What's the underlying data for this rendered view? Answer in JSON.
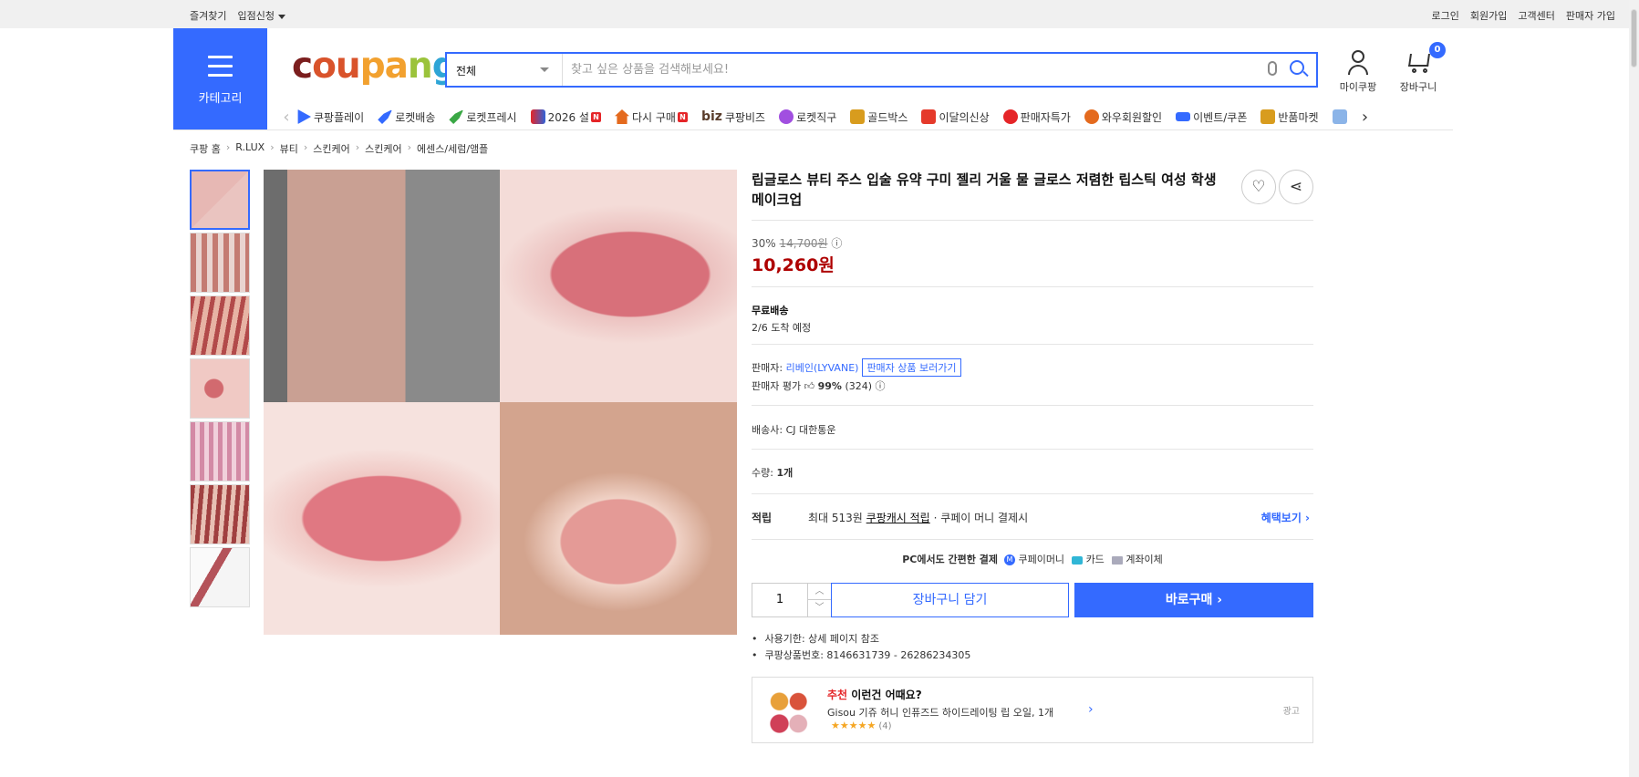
{
  "topbar": {
    "left": [
      "즐겨찾기",
      "입점신청"
    ],
    "right": [
      "로그인",
      "회원가입",
      "고객센터",
      "판매자 가입"
    ]
  },
  "header": {
    "category_label": "카테고리",
    "logo": [
      "c",
      "ou",
      "pa",
      "n",
      "g"
    ],
    "search": {
      "category": "전체",
      "placeholder": "찾고 싶은 상품을 검색해보세요!"
    },
    "mycoupang": "마이쿠팡",
    "cart": "장바구니",
    "cart_count": "0"
  },
  "nav": {
    "items": [
      {
        "label": "쿠팡플레이",
        "icon": "play-icon",
        "color": "#346aff",
        "new": ""
      },
      {
        "label": "로켓배송",
        "icon": "rocket-icon",
        "color": "#346aff",
        "new": ""
      },
      {
        "label": "로켓프레시",
        "icon": "rocket-fresh-icon",
        "color": "#3aa845",
        "new": ""
      },
      {
        "label": "2026 설",
        "icon": "gift-icon",
        "color": "#2f63d8",
        "new": "N"
      },
      {
        "label": "다시 구매",
        "icon": "house-icon",
        "color": "#e46a1e",
        "new": "N"
      },
      {
        "label": "쿠팡비즈",
        "icon": "biz-icon",
        "color": "#5a3d2b",
        "new": ""
      },
      {
        "label": "로켓직구",
        "icon": "globe-icon",
        "color": "#a14fe0",
        "new": ""
      },
      {
        "label": "골드박스",
        "icon": "goldbox-icon",
        "color": "#d89c1e",
        "new": ""
      },
      {
        "label": "이달의신상",
        "icon": "bag-icon",
        "color": "#e53a2b",
        "new": ""
      },
      {
        "label": "판매자특가",
        "icon": "percent-icon",
        "color": "#e52528",
        "new": ""
      },
      {
        "label": "와우회원할인",
        "icon": "wow-icon",
        "color": "#e46a1e",
        "new": ""
      },
      {
        "label": "이벤트/쿠폰",
        "icon": "coupon-icon",
        "color": "#346aff",
        "new": ""
      },
      {
        "label": "반품마켓",
        "icon": "market-icon",
        "color": "#d89c1e",
        "new": ""
      }
    ],
    "biz_prefix": "biz"
  },
  "breadcrumbs": [
    "쿠팡 홈",
    "R.LUX",
    "뷰티",
    "스킨케어",
    "스킨케어",
    "에센스/세럼/앰플"
  ],
  "product": {
    "title": "립글로스 뷰티 주스 입술 유약 구미 젤리 거울 물 글로스 저렴한 립스틱 여성 학생 메이크업",
    "discount": "30%",
    "original_price": "14,700원",
    "price": "10,260원",
    "shipping_title": "무료배송",
    "eta": "2/6 도착 예정",
    "seller_label": "판매자:",
    "seller_name": "리베인(LYVANE)",
    "seller_button": "판매자 상품 보러가기",
    "rating_label": "판매자 평가",
    "rating_value": "99%",
    "rating_count": "(324)",
    "courier_label": "배송사:",
    "courier": "CJ 대한통운",
    "qty_label": "수량:",
    "qty_value": "1개",
    "reward_label": "적립",
    "reward_text_pre": "최대 513원",
    "reward_link": "쿠팡캐시 적립",
    "reward_text_post": "· 쿠페이 머니 결제시",
    "reward_more": "혜택보기",
    "pay_title": "PC에서도 간편한 결제",
    "pay_money": "쿠페이머니",
    "pay_card": "카드",
    "pay_bank": "계좌이체",
    "quantity": "1",
    "cart_button": "장바구니 담기",
    "buy_button": "바로구매",
    "notes": [
      "사용기한: 상세 페이지 참조",
      "쿠팡상품번호: 8146631739 - 26286234305"
    ]
  },
  "recommend": {
    "head_red": "추천",
    "head_rest": "이런건 어때요?",
    "name": "Gisou 기쥬 허니 인퓨즈드 하이드레이팅 립 오일, 1개",
    "stars": "★★★★★",
    "review_count": "(4)",
    "ad_label": "광고"
  }
}
